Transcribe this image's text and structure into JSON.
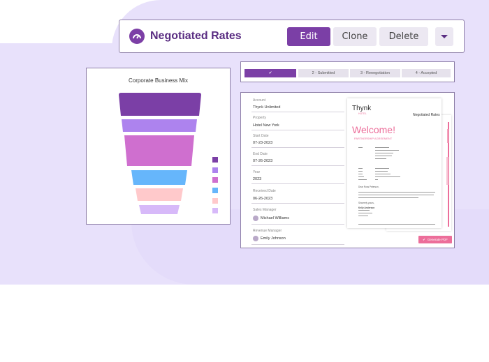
{
  "header": {
    "title": "Negotiated Rates",
    "buttons": {
      "edit": "Edit",
      "clone": "Clone",
      "delete": "Delete"
    }
  },
  "funnel": {
    "title": "Corporate Business Mix",
    "colors": [
      "#7b3fa6",
      "#ad83ee",
      "#cf6fcf",
      "#66b6fb",
      "#ffc9cb",
      "#d7b9f9"
    ]
  },
  "chart_data": {
    "type": "funnel",
    "title": "Corporate Business Mix",
    "stages": 6
  },
  "stepper": {
    "steps": [
      "✔",
      "2 - Submitted",
      "3 - Renegotiation",
      "4 - Accepted"
    ]
  },
  "form": {
    "fields": [
      {
        "label": "Account",
        "value": "Thynk Unlimited"
      },
      {
        "label": "Property",
        "value": "Hotel New York"
      },
      {
        "label": "Start Date",
        "value": "07-23-2023"
      },
      {
        "label": "End Date",
        "value": "07-26-2023"
      },
      {
        "label": "Year",
        "value": "2023"
      },
      {
        "label": "Received Date",
        "value": "06-26-2023"
      },
      {
        "label": "Sales Manager",
        "value": "Michael Williams"
      },
      {
        "label": "Revenue Manager",
        "value": "Emily Johnson"
      }
    ]
  },
  "document": {
    "brand": "Thynk",
    "brand_sub": "HOTEL",
    "corner": "Negotiated Rates",
    "welcome": "Welcome!",
    "subtitle": "PARTNERSHIP AGREEMENT",
    "greeting": "Dear Ross Peterson,",
    "sincerely": "Sincerely yours,",
    "signer": "Kelly Anderson"
  },
  "pdf_button": "Generate PDF"
}
